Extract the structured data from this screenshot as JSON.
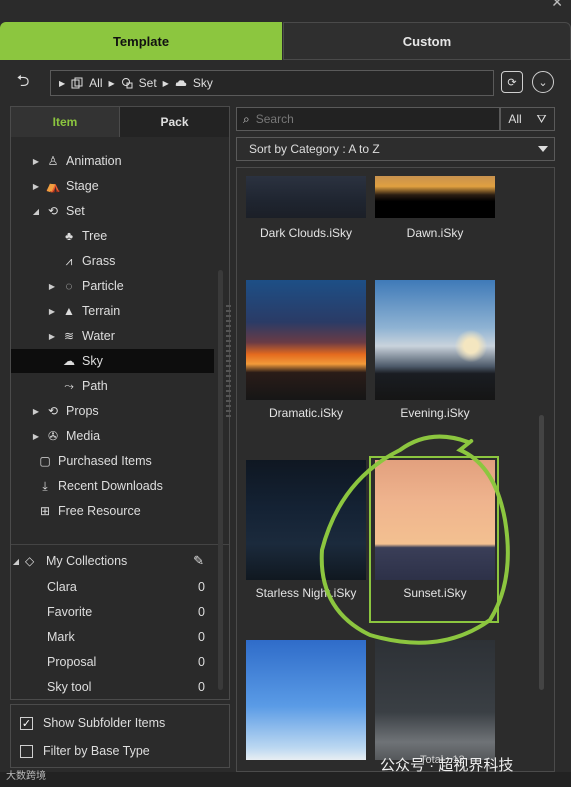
{
  "tabs": {
    "template": "Template",
    "custom": "Custom"
  },
  "breadcrumb": {
    "all": "All",
    "set": "Set",
    "sky": "Sky"
  },
  "left_tabs": {
    "item": "Item",
    "pack": "Pack"
  },
  "tree": [
    {
      "label": "Animation",
      "icon": "person-icon",
      "expand": "▶"
    },
    {
      "label": "Stage",
      "icon": "stage-icon",
      "expand": "▶"
    },
    {
      "label": "Set",
      "icon": "set-icon",
      "expand": "◢"
    },
    {
      "label": "Tree",
      "icon": "tree-icon",
      "expand": ""
    },
    {
      "label": "Grass",
      "icon": "grass-icon",
      "expand": ""
    },
    {
      "label": "Particle",
      "icon": "particle-icon",
      "expand": "▶"
    },
    {
      "label": "Terrain",
      "icon": "terrain-icon",
      "expand": "▶"
    },
    {
      "label": "Water",
      "icon": "water-icon",
      "expand": "▶"
    },
    {
      "label": "Sky",
      "icon": "cloud-icon",
      "expand": ""
    },
    {
      "label": "Path",
      "icon": "path-icon",
      "expand": ""
    },
    {
      "label": "Props",
      "icon": "props-icon",
      "expand": "▶"
    },
    {
      "label": "Media",
      "icon": "media-icon",
      "expand": "▶"
    },
    {
      "label": "Purchased Items",
      "icon": "folder-icon",
      "expand": ""
    },
    {
      "label": "Recent Downloads",
      "icon": "download-icon",
      "expand": ""
    },
    {
      "label": "Free Resource",
      "icon": "gift-icon",
      "expand": ""
    }
  ],
  "collections": {
    "title": "My Collections",
    "items": [
      {
        "label": "Clara",
        "count": "0"
      },
      {
        "label": "Favorite",
        "count": "0"
      },
      {
        "label": "Mark",
        "count": "0"
      },
      {
        "label": "Proposal",
        "count": "0"
      },
      {
        "label": "Sky tool",
        "count": "0"
      }
    ]
  },
  "options": {
    "show_subfolder": "Show Subfolder Items",
    "filter_base": "Filter by Base Type"
  },
  "search": {
    "placeholder": "Search",
    "filter_all": "All"
  },
  "sort": {
    "label": "Sort by Category : A to Z"
  },
  "thumbnails": [
    {
      "name": "Dark Clouds.iSky"
    },
    {
      "name": "Dawn.iSky"
    },
    {
      "name": "Dramatic.iSky"
    },
    {
      "name": "Evening.iSky"
    },
    {
      "name": "Starless Night.iSky"
    },
    {
      "name": "Sunset.iSky"
    }
  ],
  "footer": {
    "total": "Total : 12",
    "watermark_left": "大数跨境",
    "watermark_right": "公众号 · 超视界科技"
  },
  "colors": {
    "accent": "#8cc63f",
    "bg": "#2b2b2b"
  }
}
